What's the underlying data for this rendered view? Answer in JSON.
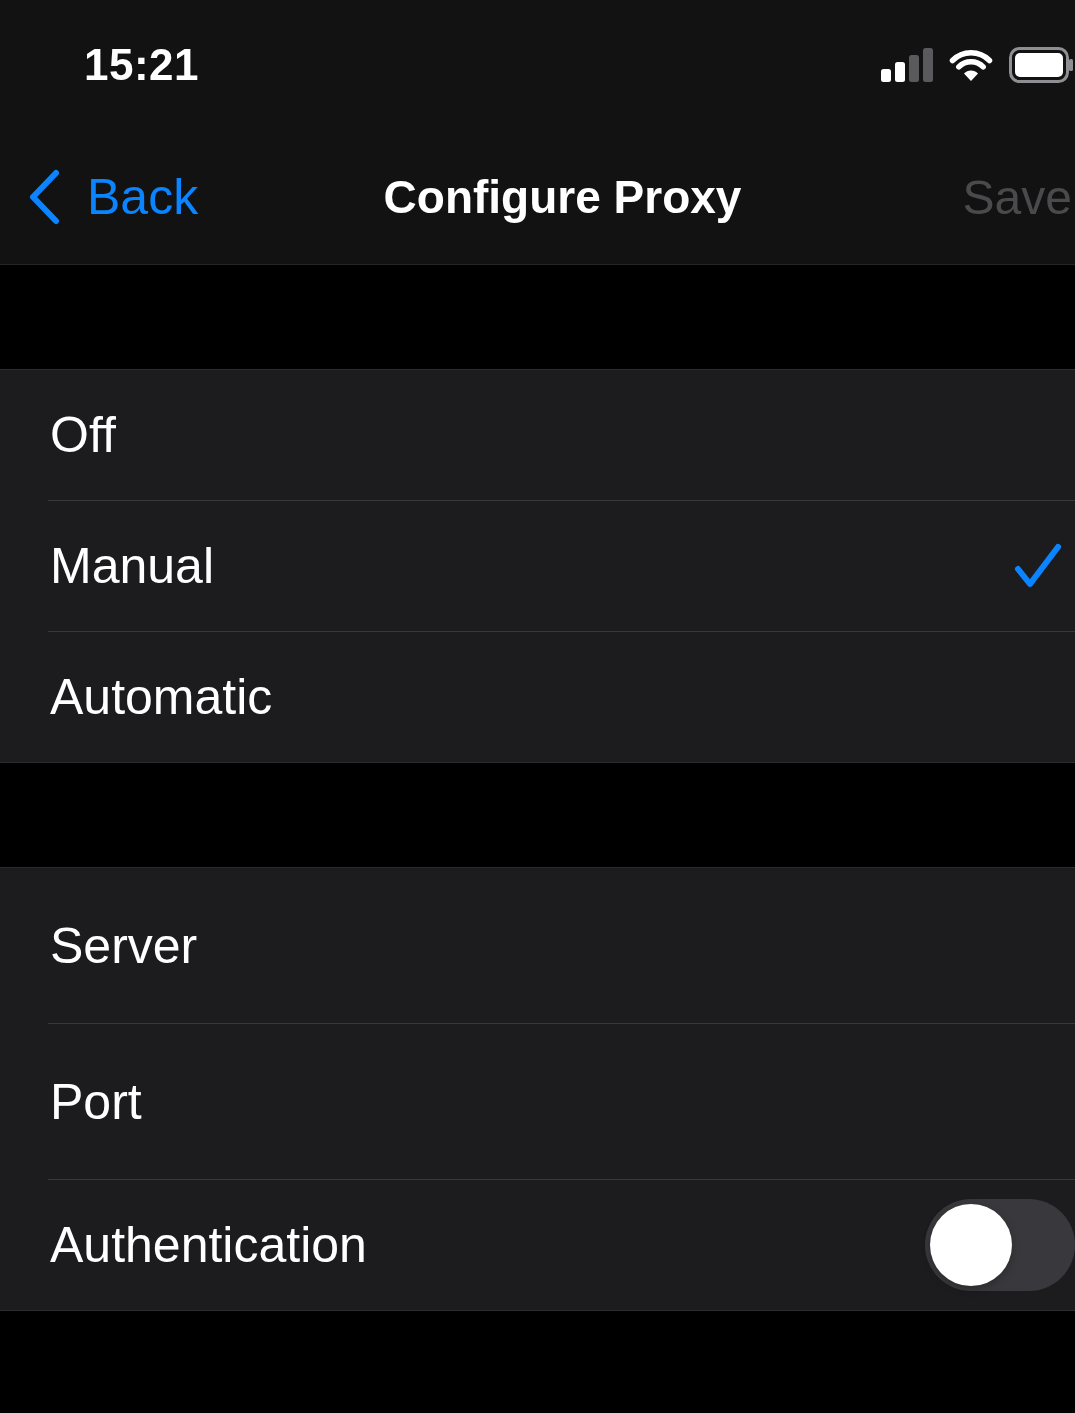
{
  "status_bar": {
    "time": "15:21"
  },
  "nav_bar": {
    "back": {
      "label": "Back"
    },
    "title": "Configure Proxy",
    "save": {
      "label": "Save",
      "disabled": true
    }
  },
  "mode_options": [
    {
      "label": "Off",
      "selected": false
    },
    {
      "label": "Manual",
      "selected": true
    },
    {
      "label": "Automatic",
      "selected": false
    }
  ],
  "settings": [
    {
      "kind": "field",
      "label": "Server"
    },
    {
      "kind": "field",
      "label": "Port"
    },
    {
      "kind": "toggle",
      "label": "Authentication",
      "on": false
    }
  ]
}
